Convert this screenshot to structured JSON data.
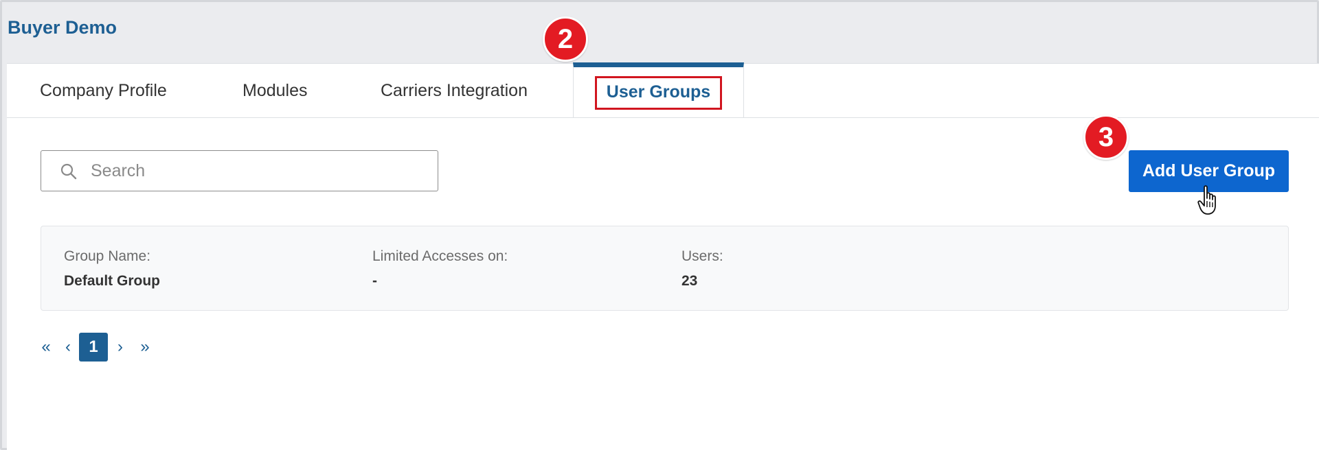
{
  "header": {
    "title": "Buyer Demo"
  },
  "tabs": [
    {
      "label": "Company Profile"
    },
    {
      "label": "Modules"
    },
    {
      "label": "Carriers Integration"
    },
    {
      "label": "User Groups",
      "active": true
    }
  ],
  "callouts": {
    "step_2": "2",
    "step_3": "3"
  },
  "search": {
    "placeholder": "Search",
    "value": ""
  },
  "toolbar": {
    "add_label": "Add User Group"
  },
  "group": {
    "name_label": "Group Name:",
    "name_value": "Default Group",
    "access_label": "Limited Accesses on:",
    "access_value": "-",
    "users_label": "Users:",
    "users_value": "23"
  },
  "pagination": {
    "first": "«",
    "prev": "‹",
    "current": "1",
    "next": "›",
    "last": "»"
  },
  "colors": {
    "brand": "#1d5f93",
    "button": "#0d66cf",
    "callout": "#e31b23",
    "highlight_border": "#d1151f"
  },
  "icons": {
    "search": "search-icon",
    "cursor": "hand-pointer-icon"
  }
}
